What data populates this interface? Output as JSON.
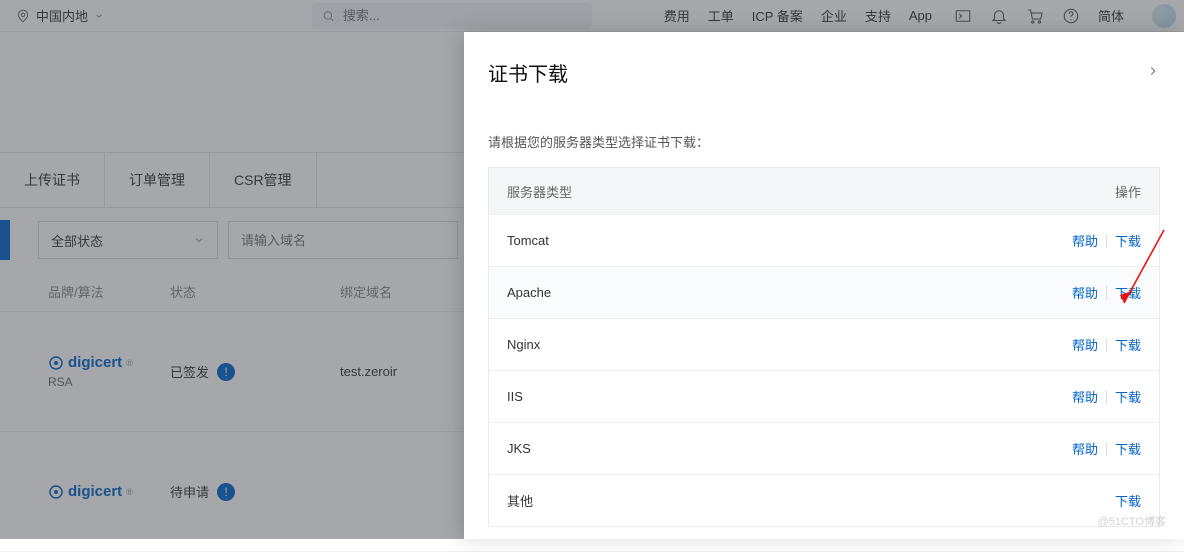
{
  "topbar": {
    "region": "中国内地",
    "search_placeholder": "搜索...",
    "links": [
      "费用",
      "工单",
      "ICP 备案",
      "企业",
      "支持",
      "App"
    ],
    "lang": "简体"
  },
  "bg": {
    "tabs": [
      "上传证书",
      "订单管理",
      "CSR管理"
    ],
    "status_filter": "全部状态",
    "domain_placeholder": "请输入域名",
    "cols": {
      "brand": "品牌/算法",
      "status": "状态",
      "domain": "绑定域名"
    },
    "rows": [
      {
        "brand": "digicert",
        "algo": "RSA",
        "status": "已签发",
        "domain": "test.zeroir"
      },
      {
        "brand": "digicert",
        "algo": "",
        "status": "待申请",
        "domain": ""
      }
    ]
  },
  "panel": {
    "title": "证书下载",
    "hint": "请根据您的服务器类型选择证书下载：",
    "header": {
      "type": "服务器类型",
      "ops": "操作"
    },
    "help_label": "帮助",
    "download_label": "下载",
    "rows": [
      {
        "name": "Tomcat",
        "help": true
      },
      {
        "name": "Apache",
        "help": true
      },
      {
        "name": "Nginx",
        "help": true
      },
      {
        "name": "IIS",
        "help": true
      },
      {
        "name": "JKS",
        "help": true
      },
      {
        "name": "其他",
        "help": false
      }
    ]
  },
  "watermark": "@51CTO博客"
}
